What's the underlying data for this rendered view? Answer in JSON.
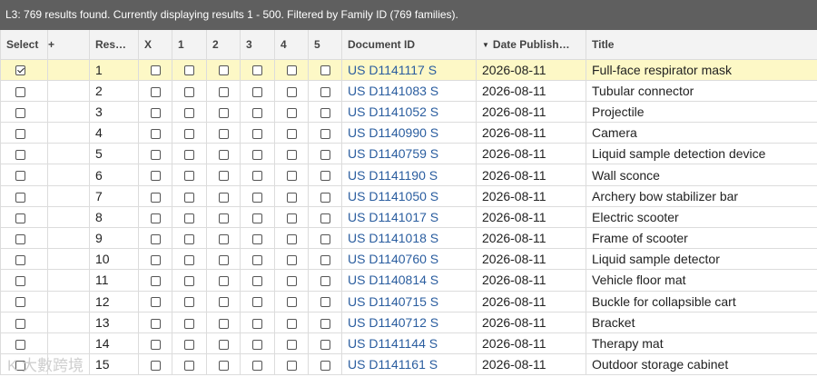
{
  "status": "L3: 769 results found. Currently displaying results 1 - 500. Filtered by Family ID (769 families).",
  "columns": {
    "select": "Select",
    "plus": "+",
    "result": "Res…",
    "x": "X",
    "c1": "1",
    "c2": "2",
    "c3": "3",
    "c4": "4",
    "c5": "5",
    "document_id": "Document ID",
    "date": "Date Publish…",
    "title": "Title"
  },
  "sort": {
    "column": "date",
    "direction": "descending",
    "arrow": "▼"
  },
  "rows": [
    {
      "num": "1",
      "doc": "US D1141117 S",
      "date": "2026-08-11",
      "title": "Full-face respirator mask",
      "selected": true
    },
    {
      "num": "2",
      "doc": "US D1141083 S",
      "date": "2026-08-11",
      "title": "Tubular connector",
      "selected": false
    },
    {
      "num": "3",
      "doc": "US D1141052 S",
      "date": "2026-08-11",
      "title": "Projectile",
      "selected": false
    },
    {
      "num": "4",
      "doc": "US D1140990 S",
      "date": "2026-08-11",
      "title": "Camera",
      "selected": false
    },
    {
      "num": "5",
      "doc": "US D1140759 S",
      "date": "2026-08-11",
      "title": "Liquid sample detection device",
      "selected": false
    },
    {
      "num": "6",
      "doc": "US D1141190 S",
      "date": "2026-08-11",
      "title": "Wall sconce",
      "selected": false
    },
    {
      "num": "7",
      "doc": "US D1141050 S",
      "date": "2026-08-11",
      "title": "Archery bow stabilizer bar",
      "selected": false
    },
    {
      "num": "8",
      "doc": "US D1141017 S",
      "date": "2026-08-11",
      "title": "Electric scooter",
      "selected": false
    },
    {
      "num": "9",
      "doc": "US D1141018 S",
      "date": "2026-08-11",
      "title": "Frame of scooter",
      "selected": false
    },
    {
      "num": "10",
      "doc": "US D1140760 S",
      "date": "2026-08-11",
      "title": "Liquid sample detector",
      "selected": false
    },
    {
      "num": "11",
      "doc": "US D1140814 S",
      "date": "2026-08-11",
      "title": "Vehicle floor mat",
      "selected": false
    },
    {
      "num": "12",
      "doc": "US D1140715 S",
      "date": "2026-08-11",
      "title": "Buckle for collapsible cart",
      "selected": false
    },
    {
      "num": "13",
      "doc": "US D1140712 S",
      "date": "2026-08-11",
      "title": "Bracket",
      "selected": false
    },
    {
      "num": "14",
      "doc": "US D1141144 S",
      "date": "2026-08-11",
      "title": "Therapy mat",
      "selected": false
    },
    {
      "num": "15",
      "doc": "US D1141161 S",
      "date": "2026-08-11",
      "title": "Outdoor storage cabinet",
      "selected": false
    }
  ],
  "watermark": "K 大數跨境",
  "colors": {
    "header_bar": "#5f5f5f",
    "selected_row": "#fdf8c6",
    "link": "#2a5d9f"
  }
}
